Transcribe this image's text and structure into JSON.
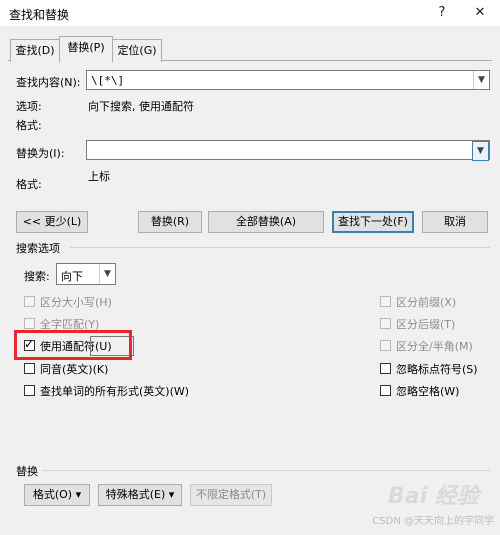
{
  "window": {
    "title": "查找和替换",
    "help_btn": "?",
    "close_btn": "✕"
  },
  "tabs": [
    {
      "label": "查找(D)",
      "active": false
    },
    {
      "label": "替换(P)",
      "active": true
    },
    {
      "label": "定位(G)",
      "active": false
    }
  ],
  "find": {
    "label": "查找内容(N):",
    "value": "\\[*\\]",
    "options_label": "选项:",
    "options_value": "向下搜索, 使用通配符",
    "format_label": "格式:"
  },
  "replace": {
    "label": "替换为(I):",
    "value": "",
    "format_label": "格式:",
    "format_value": "上标"
  },
  "buttons": {
    "less": "<< 更少(L)",
    "replace": "替换(R)",
    "replace_all": "全部替换(A)",
    "find_next": "查找下一处(F)",
    "cancel": "取消"
  },
  "search_options": {
    "section_title": "搜索选项",
    "search_label": "搜索:",
    "search_value": "向下",
    "left": [
      {
        "label": "区分大小写(H)",
        "checked": false,
        "enabled": false
      },
      {
        "label": "全字匹配(Y)",
        "checked": false,
        "enabled": false
      },
      {
        "label": "使用通配符(U)",
        "checked": true,
        "enabled": true
      },
      {
        "label": "同音(英文)(K)",
        "checked": false,
        "enabled": true
      },
      {
        "label": "查找单词的所有形式(英文)(W)",
        "checked": false,
        "enabled": true
      }
    ],
    "right": [
      {
        "label": "区分前缀(X)",
        "checked": false,
        "enabled": false
      },
      {
        "label": "区分后缀(T)",
        "checked": false,
        "enabled": false
      },
      {
        "label": "区分全/半角(M)",
        "checked": false,
        "enabled": false
      },
      {
        "label": "忽略标点符号(S)",
        "checked": false,
        "enabled": true
      },
      {
        "label": "忽略空格(W)",
        "checked": false,
        "enabled": true
      }
    ]
  },
  "replace_section": {
    "title": "替换",
    "format_btn": "格式(O) ▾",
    "special_btn": "特殊格式(E) ▾",
    "no_format_btn": "不限定格式(T)"
  },
  "watermark": {
    "csdn": "CSDN @天天向上的字同学",
    "baidu": "Bai 经验"
  },
  "colors": {
    "highlight": "#e8262b",
    "focus_border": "#3c7fb1"
  }
}
